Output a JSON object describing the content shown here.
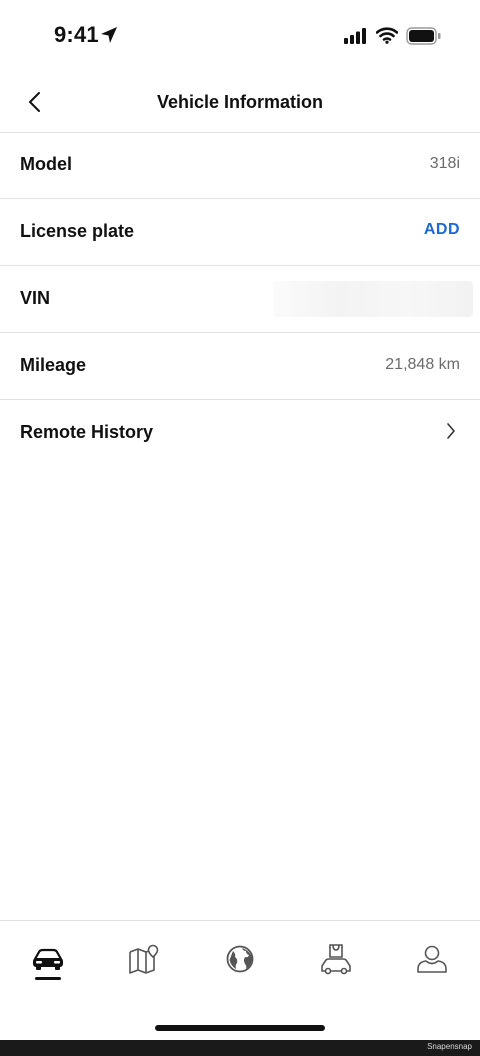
{
  "status_bar": {
    "time": "9:41"
  },
  "header": {
    "title": "Vehicle Information"
  },
  "rows": [
    {
      "label": "Model",
      "value": "318i"
    },
    {
      "label": "License plate",
      "action": "ADD"
    },
    {
      "label": "VIN",
      "value": ""
    },
    {
      "label": "Mileage",
      "value": "21,848 km"
    },
    {
      "label": "Remote History"
    }
  ],
  "tab_bar": {
    "tabs": [
      {
        "icon": "car-icon",
        "selected": true
      },
      {
        "icon": "map-icon",
        "selected": false
      },
      {
        "icon": "globe-icon",
        "selected": false
      },
      {
        "icon": "shop-icon",
        "selected": false
      },
      {
        "icon": "profile-icon",
        "selected": false
      }
    ]
  },
  "footer": {
    "watermark": "Snapensnap"
  },
  "colors": {
    "accent": "#1c69d4",
    "text": "#111111",
    "secondary": "#6b6b6b",
    "divider": "#e2e2e2"
  }
}
